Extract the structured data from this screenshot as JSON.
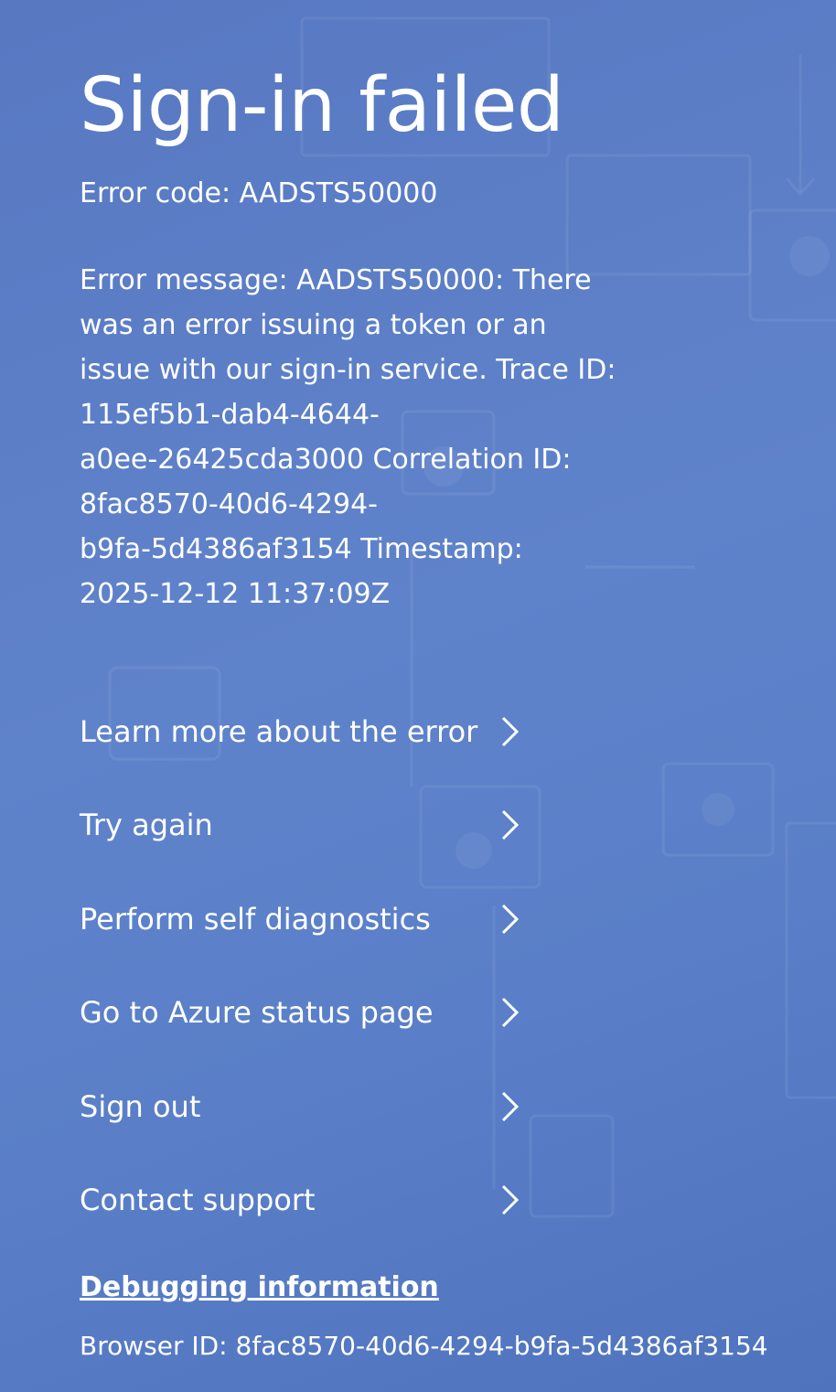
{
  "page": {
    "title": "Sign-in failed",
    "error_code": "Error code: AADSTS50000",
    "error_message": "Error message: AADSTS50000: There\nwas an error issuing a token or an\nissue with our sign-in service. Trace ID:\n115ef5b1-dab4-4644-\na0ee-26425cda3000 Correlation ID:\n8fac8570-40d6-4294-\nb9fa-5d4386af3154 Timestamp:\n2025-12-12 11:37:09Z"
  },
  "actions": [
    {
      "label": "Learn more about the error",
      "icon": "chevron-right-icon"
    },
    {
      "label": "Try again",
      "icon": "chevron-right-icon"
    },
    {
      "label": "Perform self diagnostics",
      "icon": "chevron-right-icon"
    },
    {
      "label": "Go to Azure status page",
      "icon": "chevron-right-icon"
    },
    {
      "label": "Sign out",
      "icon": "chevron-right-icon"
    },
    {
      "label": "Contact support",
      "icon": "chevron-right-icon"
    }
  ],
  "debug": {
    "link_label": "Debugging information",
    "browser_id": "Browser ID: 8fac8570-40d6-4294-b9fa-5d4386af3154"
  },
  "colors": {
    "background": "#5a7fc8",
    "text": "#ffffff"
  }
}
